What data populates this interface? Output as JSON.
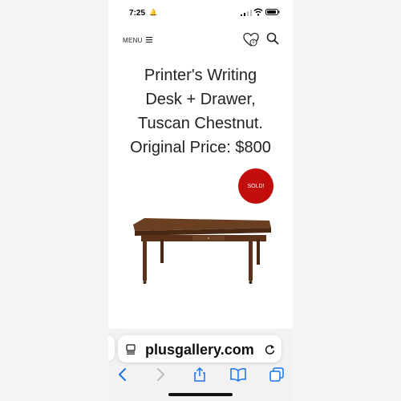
{
  "status_bar": {
    "time": "7:25",
    "bell_symbol": "🔔"
  },
  "nav": {
    "menu_label": "MENU",
    "wishlist_count": "0"
  },
  "product": {
    "title_lines": [
      "Printer's Writing",
      "Desk + Drawer,",
      "Tuscan Chestnut.",
      "Original Price: $800"
    ],
    "badge": "SOLD!",
    "image_icon": "desk-image"
  },
  "browser": {
    "url": "plusgallery.com"
  },
  "colors": {
    "badge": "#c30d0d",
    "text": "#222222",
    "accent_blue": "#1a73e8"
  }
}
